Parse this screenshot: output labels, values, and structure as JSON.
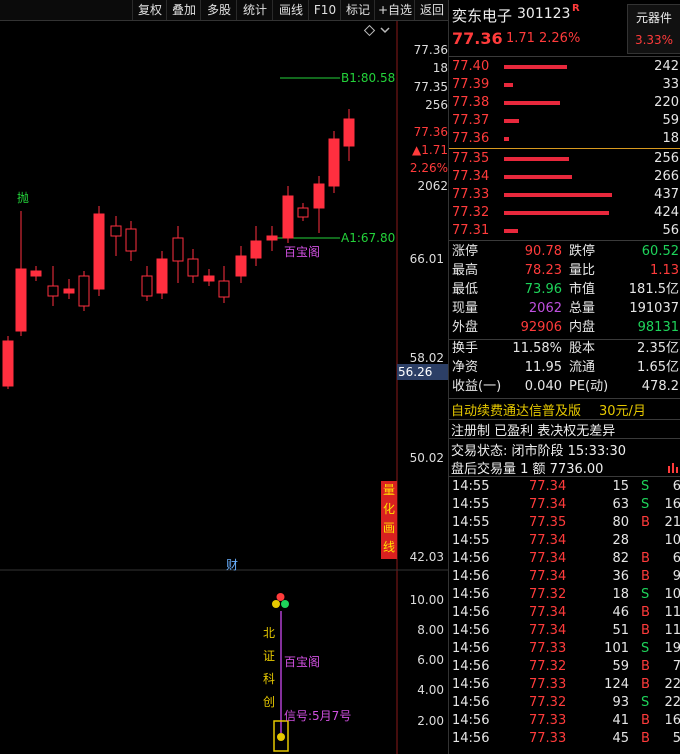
{
  "toolbar": {
    "items": [
      "复权",
      "叠加",
      "多股",
      "统计",
      "画线",
      "F10",
      "标记",
      "+自选",
      "返回"
    ]
  },
  "chart": {
    "top_axis": [
      "77.36",
      "18",
      "77.35",
      "256",
      "77.36",
      "▲1.71",
      "2.26%",
      "2062"
    ],
    "price_labels": [
      "66.01",
      "58.02",
      "50.02",
      "42.03"
    ],
    "current_price": "56.26",
    "b1_label": "B1:80.58",
    "a1_label": "A1:67.80",
    "baobao_label": "百宝阁",
    "sell_marker": "抛",
    "cai_marker": "财",
    "quant_button": "量化画线",
    "lower_axis": [
      "10.00",
      "8.00",
      "6.00",
      "4.00",
      "2.00"
    ],
    "lower_text_vertical": "北证科创",
    "lower_baobao": "百宝阁",
    "signal_text": "信号:5月7号"
  },
  "quote": {
    "name": "奕东电子",
    "code": "301123",
    "r_badge": "R",
    "price": "77.36",
    "change": "1.71",
    "change_pct": "2.26%",
    "sector": "元器件",
    "sector_pct": "3.33%",
    "asks": [
      {
        "price": "77.40",
        "vol": "242",
        "bar": 0.58
      },
      {
        "price": "77.39",
        "vol": "33",
        "bar": 0.08
      },
      {
        "price": "77.38",
        "vol": "220",
        "bar": 0.52
      },
      {
        "price": "77.37",
        "vol": "59",
        "bar": 0.14
      },
      {
        "price": "77.36",
        "vol": "18",
        "bar": 0.05
      }
    ],
    "bids": [
      {
        "price": "77.35",
        "vol": "256",
        "bar": 0.6
      },
      {
        "price": "77.34",
        "vol": "266",
        "bar": 0.63
      },
      {
        "price": "77.33",
        "vol": "437",
        "bar": 1.0
      },
      {
        "price": "77.32",
        "vol": "424",
        "bar": 0.97
      },
      {
        "price": "77.31",
        "vol": "56",
        "bar": 0.13
      }
    ],
    "stats": [
      {
        "l1": "涨停",
        "v1": "90.78",
        "c1": "red",
        "l2": "跌停",
        "v2": "60.52",
        "c2": "grn"
      },
      {
        "l1": "最高",
        "v1": "78.23",
        "c1": "red",
        "l2": "量比",
        "v2": "1.13",
        "c2": "red"
      },
      {
        "l1": "最低",
        "v1": "73.96",
        "c1": "grn",
        "l2": "市值",
        "v2": "181.5亿",
        "c2": "wht"
      },
      {
        "l1": "现量",
        "v1": "2062",
        "c1": "mag",
        "l2": "总量",
        "v2": "191037",
        "c2": "wht"
      },
      {
        "l1": "外盘",
        "v1": "92906",
        "c1": "red",
        "l2": "内盘",
        "v2": "98131",
        "c2": "grn"
      }
    ],
    "stats2": [
      {
        "l1": "换手",
        "v1": "11.58%",
        "l2": "股本",
        "v2": "2.35亿"
      },
      {
        "l1": "净资",
        "v1": "11.95",
        "l2": "流通",
        "v2": "1.65亿"
      },
      {
        "l1": "收益(一)",
        "v1": "0.040",
        "l2": "PE(动)",
        "v2": "478.2"
      }
    ],
    "ad_text": "自动续费通达信普及版",
    "ad_price": "30元/月",
    "reg_text": "注册制 已盈利 表决权无差异",
    "trade_status": "交易状态: 闭市阶段 15:33:30",
    "after_hours": "盘后交易量 1 额 7736.00"
  },
  "ticks": [
    {
      "t": "14:55",
      "p": "77.34",
      "v": "15",
      "s": "S",
      "n": "6",
      "pc": "red",
      "sc": "grn"
    },
    {
      "t": "14:55",
      "p": "77.34",
      "v": "63",
      "s": "S",
      "n": "16",
      "pc": "red",
      "sc": "grn"
    },
    {
      "t": "14:55",
      "p": "77.35",
      "v": "80",
      "s": "B",
      "n": "21",
      "pc": "red",
      "sc": "red"
    },
    {
      "t": "14:55",
      "p": "77.34",
      "v": "28",
      "s": "",
      "n": "10",
      "pc": "red",
      "sc": "wht"
    },
    {
      "t": "14:56",
      "p": "77.34",
      "v": "82",
      "s": "B",
      "n": "6",
      "pc": "red",
      "sc": "red"
    },
    {
      "t": "14:56",
      "p": "77.34",
      "v": "36",
      "s": "B",
      "n": "9",
      "pc": "red",
      "sc": "red"
    },
    {
      "t": "14:56",
      "p": "77.32",
      "v": "18",
      "s": "S",
      "n": "10",
      "pc": "red",
      "sc": "grn"
    },
    {
      "t": "14:56",
      "p": "77.34",
      "v": "46",
      "s": "B",
      "n": "11",
      "pc": "red",
      "sc": "red"
    },
    {
      "t": "14:56",
      "p": "77.34",
      "v": "51",
      "s": "B",
      "n": "11",
      "pc": "red",
      "sc": "red"
    },
    {
      "t": "14:56",
      "p": "77.33",
      "v": "101",
      "s": "S",
      "n": "19",
      "pc": "red",
      "sc": "grn"
    },
    {
      "t": "14:56",
      "p": "77.32",
      "v": "59",
      "s": "B",
      "n": "7",
      "pc": "red",
      "sc": "red"
    },
    {
      "t": "14:56",
      "p": "77.33",
      "v": "124",
      "s": "B",
      "n": "22",
      "pc": "red",
      "sc": "red"
    },
    {
      "t": "14:56",
      "p": "77.32",
      "v": "93",
      "s": "S",
      "n": "22",
      "pc": "red",
      "sc": "grn"
    },
    {
      "t": "14:56",
      "p": "77.33",
      "v": "41",
      "s": "B",
      "n": "16",
      "pc": "red",
      "sc": "red"
    },
    {
      "t": "14:56",
      "p": "77.33",
      "v": "45",
      "s": "B",
      "n": "5",
      "pc": "red",
      "sc": "red"
    }
  ],
  "colors": {
    "up": "#ff2f3f",
    "down": "#1ed35a",
    "bg": "#000000"
  }
}
